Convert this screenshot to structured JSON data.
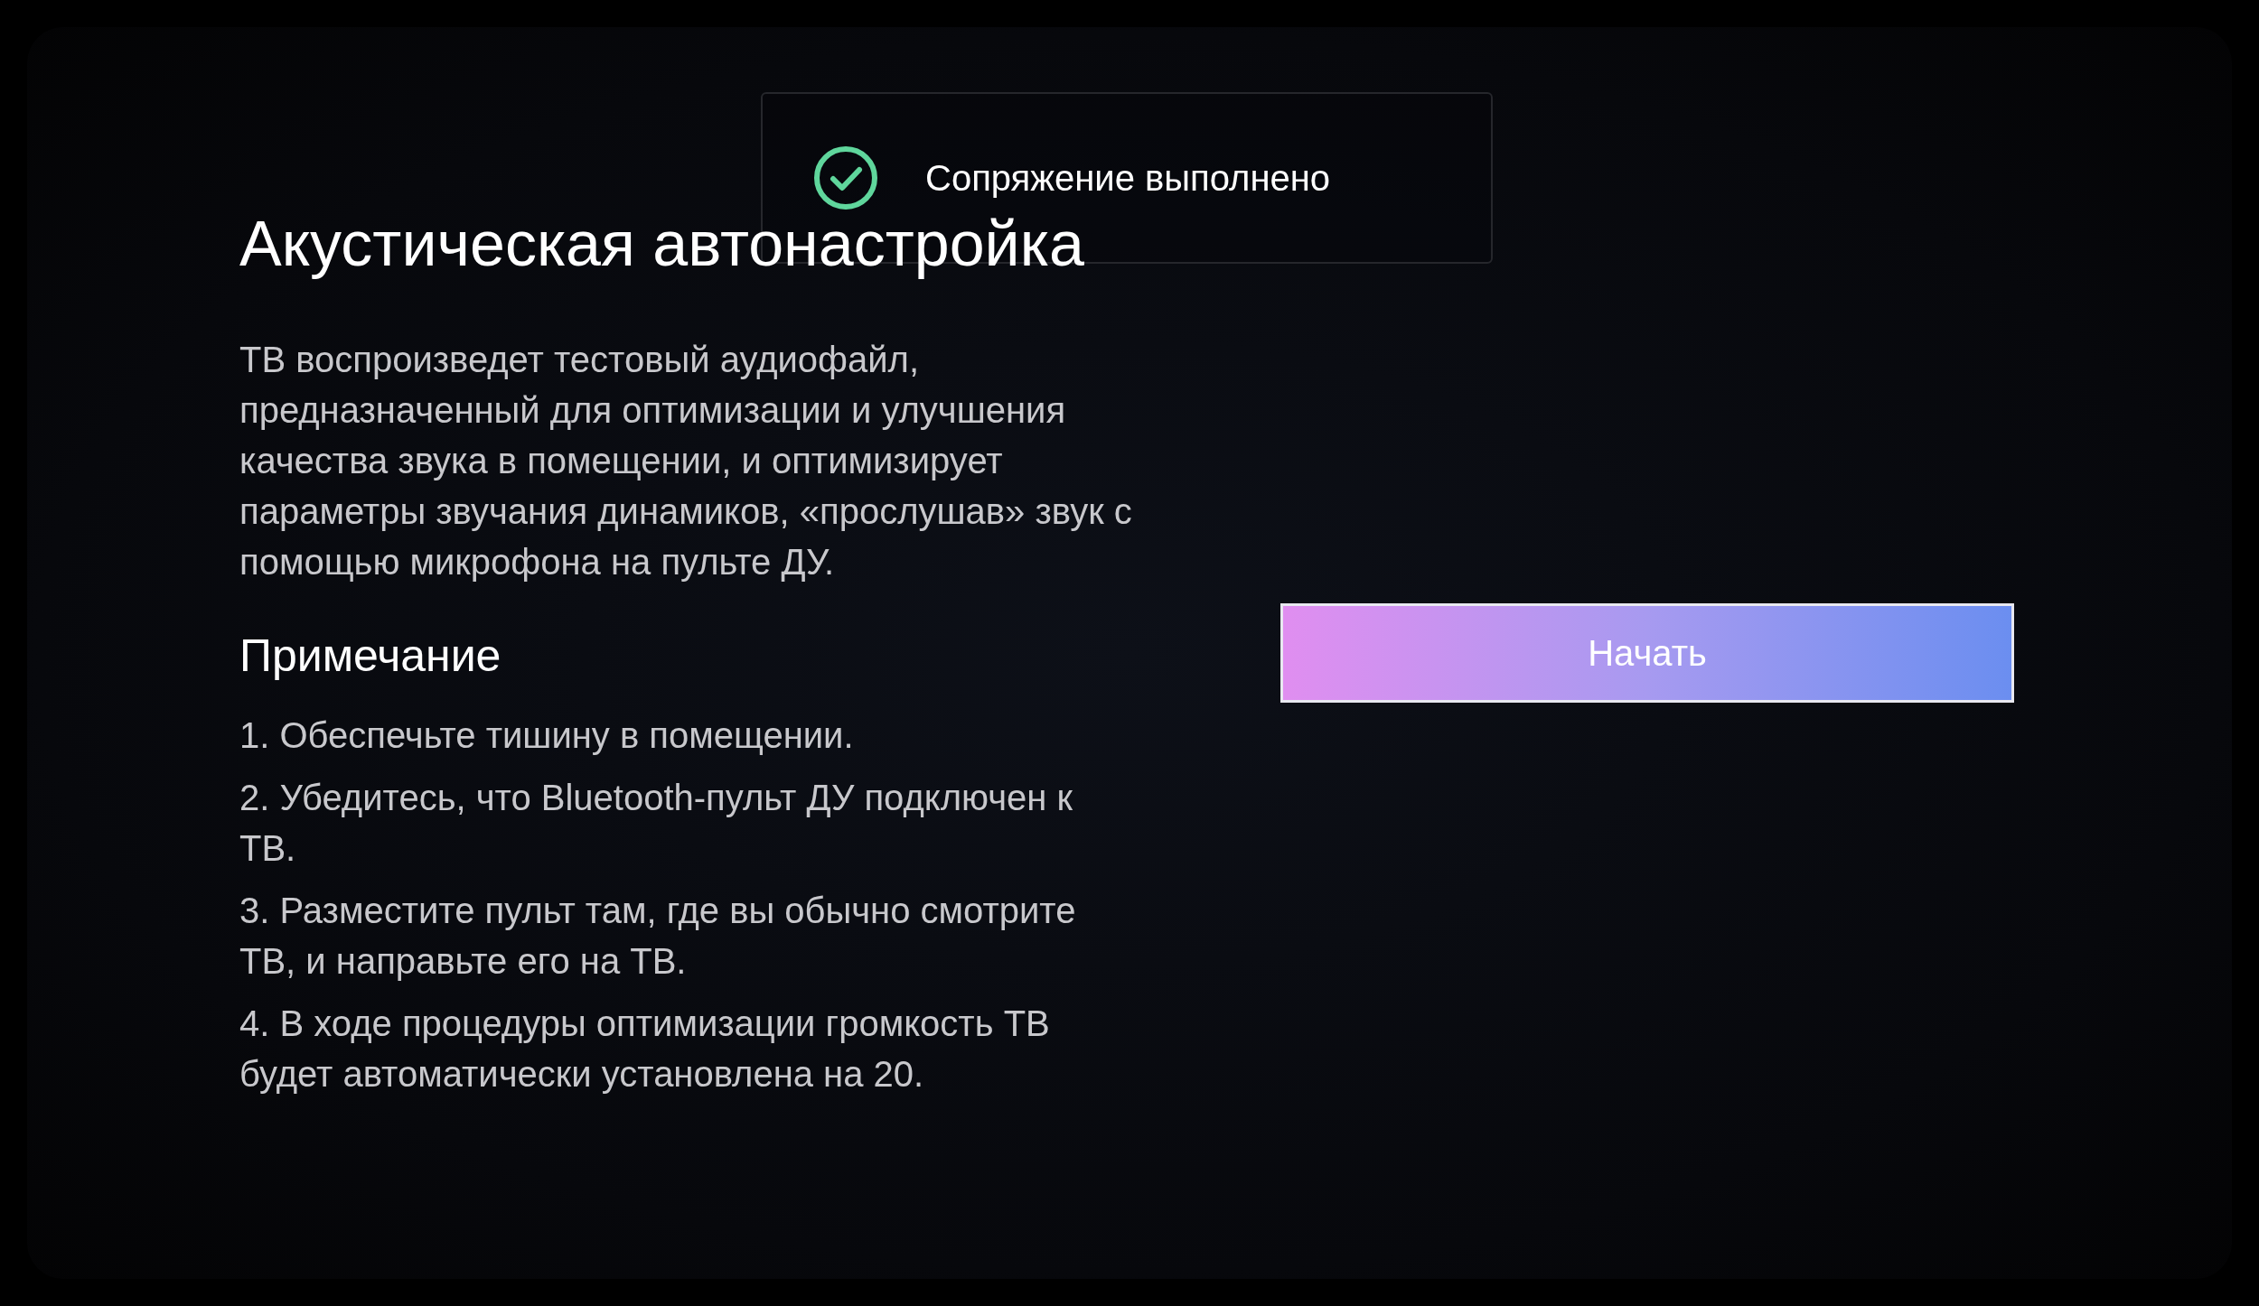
{
  "toast": {
    "message": "Сопряжение выполнено"
  },
  "title": "Акустическая автонастройка",
  "description": "ТВ воспроизведет тестовый аудиофайл, предназначенный для оптимизации и улучшения качества звука в помещении, и оптимизирует параметры звучания динамиков, «прослушав» звук с помощью микрофона на пульте ДУ.",
  "note": {
    "heading": "Примечание",
    "items": [
      "1. Обеспечьте тишину в помещении.",
      "2. Убедитесь, что Bluetooth-пульт ДУ подключен к ТВ.",
      "3. Разместите пульт там, где вы обычно смотрите ТВ, и направьте его на ТВ.",
      "4. В ходе процедуры оптимизации громкость ТВ будет автоматически установлена на 20."
    ]
  },
  "start_button": {
    "label": "Начать"
  }
}
